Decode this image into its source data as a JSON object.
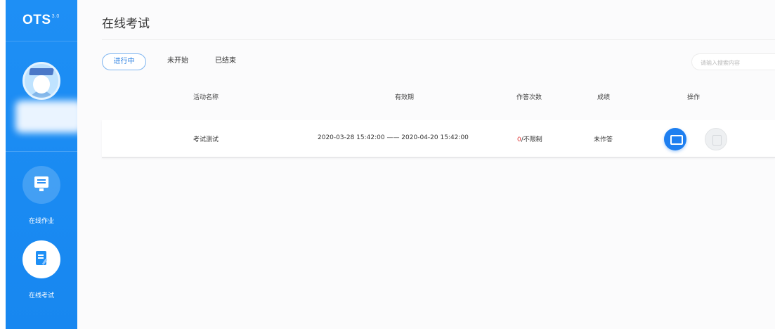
{
  "app": {
    "logo": "OTS",
    "logo_sup": "3.0"
  },
  "sidebar": {
    "items": [
      {
        "label": "在线作业",
        "icon": "homework-icon"
      },
      {
        "label": "在线考试",
        "icon": "exam-icon",
        "active": true
      }
    ]
  },
  "page": {
    "title": "在线考试"
  },
  "tabs": [
    {
      "label": "进行中",
      "active": true
    },
    {
      "label": "未开始"
    },
    {
      "label": "已结束"
    }
  ],
  "search": {
    "placeholder": "请输入搜索内容"
  },
  "table": {
    "columns": [
      "活动名称",
      "有效期",
      "作答次数",
      "成绩",
      "操作"
    ],
    "rows": [
      {
        "name": "考试测试",
        "validity": "2020-03-28 15:42:00 —— 2020-04-20 15:42:00",
        "attempts_used": "0",
        "attempts_limit": "/不限制",
        "score": "未作答"
      }
    ]
  },
  "colors": {
    "primary": "#1e8ff5",
    "danger": "#e03a3a"
  }
}
